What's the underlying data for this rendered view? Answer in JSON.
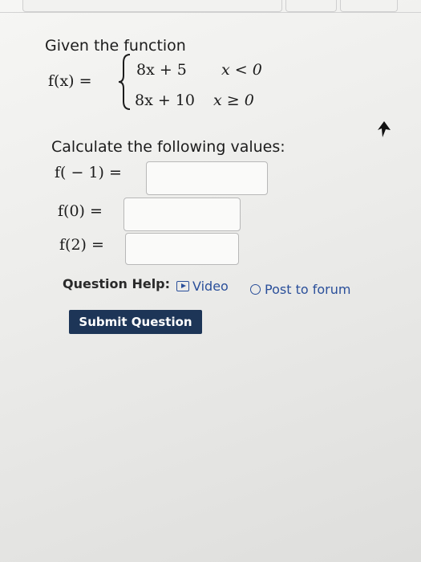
{
  "intro": "Given the function",
  "function": {
    "label": "f(x) =",
    "cases": [
      {
        "expr": "8x + 5",
        "cond": "x < 0"
      },
      {
        "expr": "8x + 10",
        "cond": "x ≥ 0"
      }
    ]
  },
  "calc_title": "Calculate the following values:",
  "questions": [
    {
      "label": "f( − 1) =",
      "value": ""
    },
    {
      "label": "f(0) =",
      "value": ""
    },
    {
      "label": "f(2) =",
      "value": ""
    }
  ],
  "help": {
    "label": "Question Help:",
    "video_label": "Video",
    "forum_label": "Post to forum"
  },
  "submit_label": "Submit Question",
  "colors": {
    "link": "#2a4f9a",
    "button_bg": "#1d3557",
    "button_text": "#ffffff"
  },
  "icons": {
    "video": "video-play-icon",
    "forum": "speech-bubble-icon",
    "cursor": "mouse-pointer-icon"
  }
}
